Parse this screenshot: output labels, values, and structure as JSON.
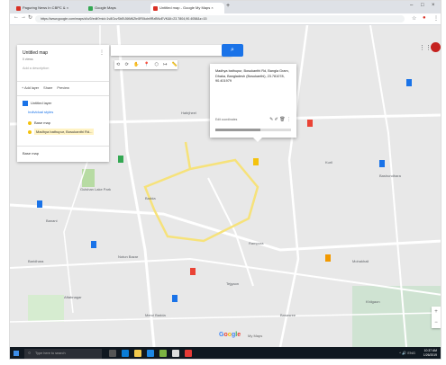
{
  "browser": {
    "tabs": [
      {
        "title": "Paguring News In CBPC & ×",
        "active": false,
        "favicon_color": "#d93025"
      },
      {
        "title": "Google Maps",
        "active": false,
        "favicon_color": "#34a853"
      },
      {
        "title": "Untitled map - Google My Maps ×",
        "active": true,
        "favicon_color": "#d93025"
      }
    ],
    "new_tab": "+",
    "window_controls": [
      "–",
      "□",
      "×"
    ],
    "back": "←",
    "forward": "→",
    "reload": "↻",
    "url": "https://www.google.com/maps/d/u/0/edit?mid=1v8GcvSbEtJ6tM6Ztn5R0kdn9RzBNcEVK&ll=23.7804,90.4058&z=15"
  },
  "map_panel": {
    "title": "Untitled map",
    "subtitle": "0 views",
    "description": "Add a description",
    "menu": "⋮",
    "buttons": [
      "+ Add layer",
      "Share",
      "Preview"
    ],
    "layers": [
      {
        "label": "Untitled layer",
        "type": "layer"
      },
      {
        "label": "Individual styles",
        "type": "link"
      },
      {
        "label": "Base map",
        "type": "item"
      },
      {
        "label": "Madhya bathupur, Bosukanthi Rd...",
        "type": "selected"
      }
    ],
    "base_map": "Base map"
  },
  "search": {
    "placeholder": "",
    "button_icon": "search-icon"
  },
  "tools": [
    "⟲",
    "⟳",
    "✋",
    "📍",
    "⬡",
    "↦",
    "📏"
  ],
  "popup": {
    "address": "Madhya bathupur, Bosukanthi Rd, Bangla Gram, Dhaka, Bangladesh (Bosukanthi), 23.781078, 90.401979",
    "footer": "Edit coordinates",
    "icons": [
      "✎",
      "✐",
      "🗑",
      "⋮"
    ]
  },
  "map_labels": [
    "Gulshan Lake Park",
    "Hatirjheel",
    "Kuril",
    "Badda",
    "Banani",
    "Rampura",
    "Bashundhara",
    "Baridhara",
    "Notun Bazar",
    "Mohakhali",
    "Tejgaon",
    "Aftabnagar",
    "Merul Badda",
    "Banasree",
    "Khilgaon"
  ],
  "map_controls": {
    "zoom_in": "+",
    "zoom_out": "−"
  },
  "google_logo": "Google",
  "google_suffix": "My Maps",
  "taskbar": {
    "search_placeholder": "Type here to search",
    "clock_time": "10:37 AM",
    "clock_date": "1/26/2019",
    "tray": "^ 🔊 ENG"
  }
}
